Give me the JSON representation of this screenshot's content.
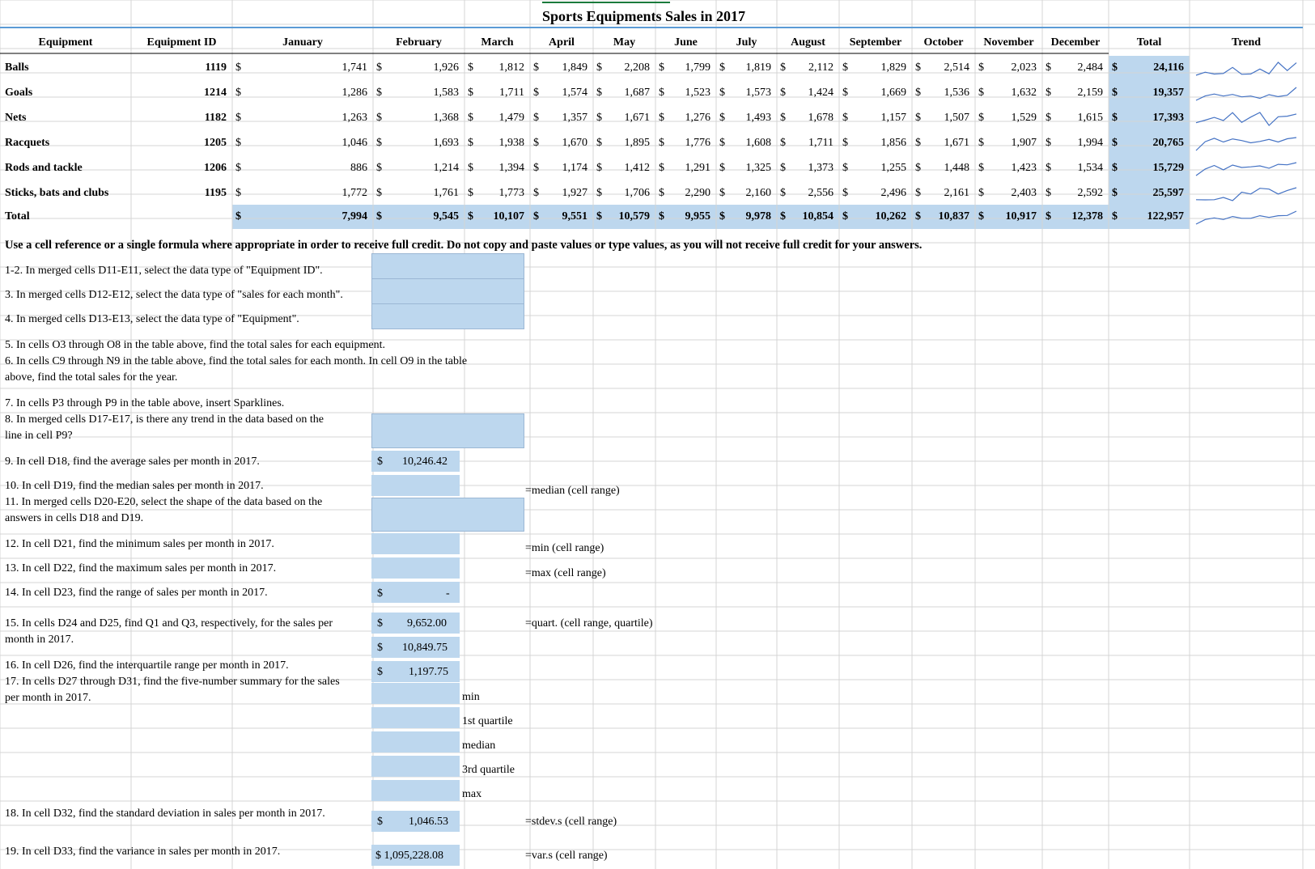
{
  "title": "Sports Equipments Sales in 2017",
  "headers": [
    "Equipment",
    "Equipment ID",
    "January",
    "February",
    "March",
    "April",
    "May",
    "June",
    "July",
    "August",
    "September",
    "October",
    "November",
    "December",
    "Total",
    "Trend"
  ],
  "currency": "$",
  "rows": [
    {
      "name": "Balls",
      "id": "1119",
      "values": [
        "1,741",
        "1,926",
        "1,812",
        "1,849",
        "2,208",
        "1,799",
        "1,819",
        "2,112",
        "1,829",
        "2,514",
        "2,023",
        "2,484"
      ],
      "total": "24,116",
      "trend": [
        1741,
        1926,
        1812,
        1849,
        2208,
        1799,
        1819,
        2112,
        1829,
        2514,
        2023,
        2484
      ]
    },
    {
      "name": "Goals",
      "id": "1214",
      "values": [
        "1,286",
        "1,583",
        "1,711",
        "1,574",
        "1,687",
        "1,523",
        "1,573",
        "1,424",
        "1,669",
        "1,536",
        "1,632",
        "2,159"
      ],
      "total": "19,357",
      "trend": [
        1286,
        1583,
        1711,
        1574,
        1687,
        1523,
        1573,
        1424,
        1669,
        1536,
        1632,
        2159
      ]
    },
    {
      "name": "Nets",
      "id": "1182",
      "values": [
        "1,263",
        "1,368",
        "1,479",
        "1,357",
        "1,671",
        "1,276",
        "1,493",
        "1,678",
        "1,157",
        "1,507",
        "1,529",
        "1,615"
      ],
      "total": "17,393",
      "trend": [
        1263,
        1368,
        1479,
        1357,
        1671,
        1276,
        1493,
        1678,
        1157,
        1507,
        1529,
        1615
      ]
    },
    {
      "name": "Racquets",
      "id": "1205",
      "values": [
        "1,046",
        "1,693",
        "1,938",
        "1,670",
        "1,895",
        "1,776",
        "1,608",
        "1,711",
        "1,856",
        "1,671",
        "1,907",
        "1,994"
      ],
      "total": "20,765",
      "trend": [
        1046,
        1693,
        1938,
        1670,
        1895,
        1776,
        1608,
        1711,
        1856,
        1671,
        1907,
        1994
      ]
    },
    {
      "name": "Rods and tackle",
      "id": "1206",
      "values": [
        "886",
        "1,214",
        "1,394",
        "1,174",
        "1,412",
        "1,291",
        "1,325",
        "1,373",
        "1,255",
        "1,448",
        "1,423",
        "1,534"
      ],
      "total": "15,729",
      "trend": [
        886,
        1214,
        1394,
        1174,
        1412,
        1291,
        1325,
        1373,
        1255,
        1448,
        1423,
        1534
      ]
    },
    {
      "name": "Sticks, bats and clubs",
      "id": "1195",
      "values": [
        "1,772",
        "1,761",
        "1,773",
        "1,927",
        "1,706",
        "2,290",
        "2,160",
        "2,556",
        "2,496",
        "2,161",
        "2,403",
        "2,592"
      ],
      "total": "25,597",
      "trend": [
        1772,
        1761,
        1773,
        1927,
        1706,
        2290,
        2160,
        2556,
        2496,
        2161,
        2403,
        2592
      ]
    }
  ],
  "total_row": {
    "name": "Total",
    "values": [
      "7,994",
      "9,545",
      "10,107",
      "9,551",
      "10,579",
      "9,955",
      "9,978",
      "10,854",
      "10,262",
      "10,837",
      "10,917",
      "12,378"
    ],
    "total": "122,957",
    "trend": [
      7994,
      9545,
      10107,
      9551,
      10579,
      9955,
      9978,
      10854,
      10262,
      10837,
      10917,
      12378
    ]
  },
  "instruction": "Use a cell reference or a single formula where appropriate in order to receive full credit. Do not copy and paste values or type values, as you will not receive full credit for your answers.",
  "questions": {
    "q1": "1-2. In merged cells D11-E11, select the data type of \"Equipment ID\".",
    "q3": "3. In merged cells D12-E12, select the data type of \"sales for each month\".",
    "q4": "4. In merged cells D13-E13, select the data type of \"Equipment\".",
    "q5": "5. In cells O3 through O8 in the table above, find the total sales for each equipment.",
    "q6a": "6. In cells C9 through N9 in the table above, find the total sales for each month. In cell O9 in the table",
    "q6b": "above, find the total sales for the year.",
    "q7": "7. In cells P3 through P9 in the table above, insert Sparklines.",
    "q8a": "8. In merged cells D17-E17, is there any trend in the data based on the",
    "q8b": "line in cell P9?",
    "q9": "9. In cell D18, find the average sales per month in 2017.",
    "q10": "10. In cell D19, find the median sales per month in 2017.",
    "q11a": "11. In merged cells D20-E20, select the shape of the data based on the",
    "q11b": "answers in cells D18 and D19.",
    "q12": "12. In cell D21, find the minimum sales per month in 2017.",
    "q13": "13. In cell D22, find the maximum sales per month in 2017.",
    "q14": "14. In cell D23, find the range of sales per month in 2017.",
    "q15a": "15. In cells D24 and D25, find Q1 and Q3, respectively, for the sales per",
    "q15b": "month in 2017.",
    "q16": "16. In cell D26, find the interquartile range per month in 2017.",
    "q17a": "17. In cells D27 through D31, find the five-number summary for the sales",
    "q17b": "per month in 2017.",
    "q18": "18. In cell D32, find the standard deviation in sales per month in 2017.",
    "q19": "19. In cell D33, find the variance in sales per month in 2017."
  },
  "answers": {
    "d18": "10,246.42",
    "d23": "-",
    "d24": "9,652.00",
    "d25": "10,849.75",
    "d26": "1,197.75",
    "d32": "1,046.53",
    "d33": "$ 1,095,228.08"
  },
  "hints": {
    "median": "=median (cell range)",
    "min": "=min (cell range)",
    "max": "=max (cell range)",
    "quart": "=quart. (cell range, quartile)",
    "stdev": "=stdev.s (cell range)",
    "var": "=var.s (cell range)"
  },
  "five_number_labels": [
    "min",
    "1st quartile",
    "median",
    "3rd quartile",
    "max"
  ],
  "colors": {
    "accent_fill": "#bdd7ee",
    "gridline": "#d4d4d4",
    "sparkline": "#4472c4",
    "title_underline": "#5b9bd5"
  }
}
